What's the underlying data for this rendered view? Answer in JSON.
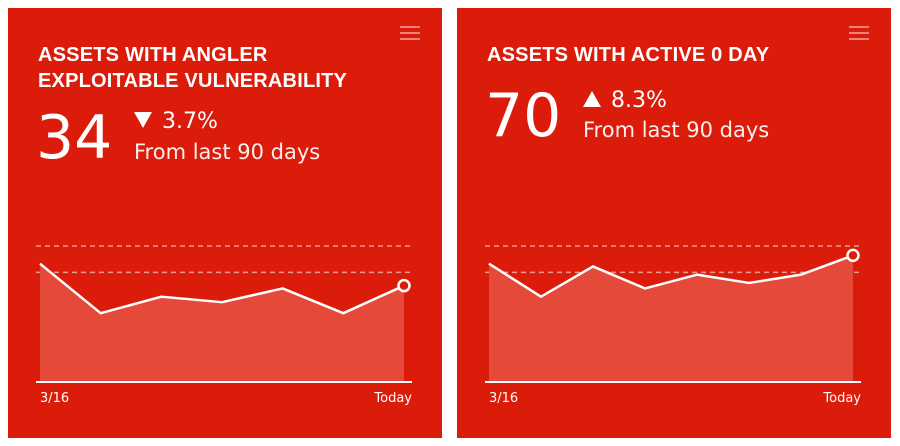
{
  "cards": [
    {
      "title": "ASSETS WITH ANGLER\nEXPLOITABLE VULNERABILITY",
      "value": "34",
      "trend_direction": "down",
      "trend_percent": "3.7%",
      "period": "From last 90 days",
      "icon": "menu-icon",
      "chart_data": {
        "type": "area",
        "x_start_label": "3/16",
        "x_end_label": "Today",
        "values": [
          0.86,
          0.5,
          0.62,
          0.58,
          0.68,
          0.5,
          0.7
        ],
        "ylim": [
          0,
          1
        ],
        "grid": "dashed"
      }
    },
    {
      "title": "ASSETS WITH ACTIVE 0 DAY",
      "value": "70",
      "trend_direction": "up",
      "trend_percent": "8.3%",
      "period": "From last 90 days",
      "icon": "menu-icon",
      "chart_data": {
        "type": "area",
        "x_start_label": "3/16",
        "x_end_label": "Today",
        "values": [
          0.86,
          0.62,
          0.84,
          0.68,
          0.78,
          0.72,
          0.78,
          0.92
        ],
        "ylim": [
          0,
          1
        ],
        "grid": "dashed"
      }
    }
  ],
  "colors": {
    "card_bg": "#dc1c0a",
    "area_fill": "#e5493a",
    "text": "#ffffff"
  }
}
